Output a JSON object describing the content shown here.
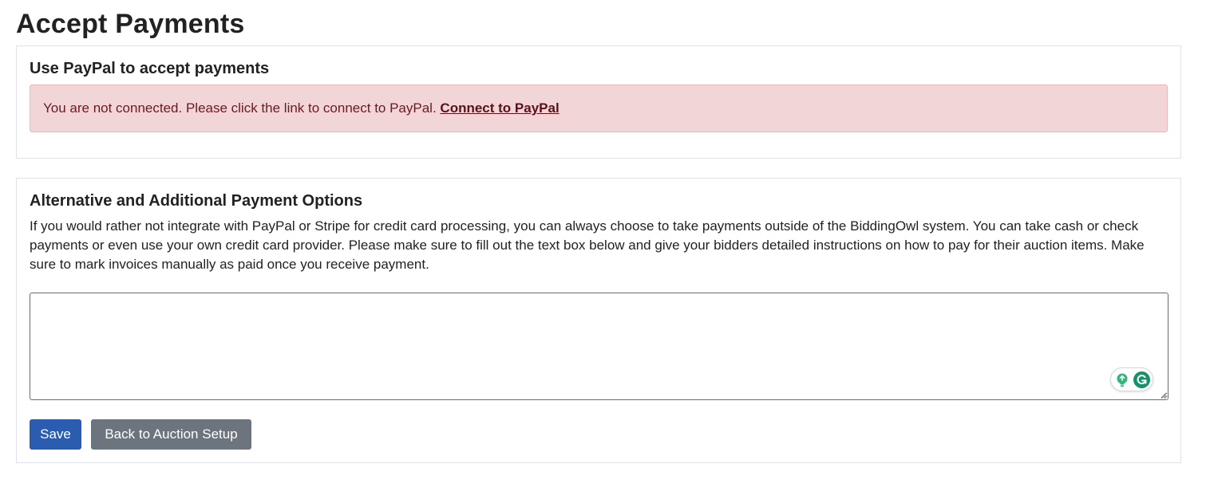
{
  "page": {
    "title": "Accept Payments"
  },
  "paypal_section": {
    "title": "Use PayPal to accept payments",
    "alert_text": "You are not connected. Please click the link to connect to PayPal.",
    "connect_link": "Connect to PayPal"
  },
  "alt_section": {
    "title": "Alternative and Additional Payment Options",
    "description": "If you would rather not integrate with PayPal or Stripe for credit card processing, you can always choose to take payments outside of the BiddingOwl system. You can take cash or check payments or even use your own credit card provider. Please make sure to fill out the text box below and give your bidders detailed instructions on how to pay for their auction items. Make sure to mark invoices manually as paid once you receive payment.",
    "instructions_value": "",
    "save_label": "Save",
    "back_label": "Back to Auction Setup"
  },
  "colors": {
    "alert_bg": "#f2d5d7",
    "alert_text": "#6a1a21",
    "primary_button": "#2a5db0",
    "secondary_button": "#6c757d",
    "textarea_focus_border": "#3a8a4a",
    "grammarly_green": "#15906b"
  },
  "icons": {
    "grammarly_suggestion": "lightbulb-icon",
    "grammarly_logo": "grammarly-g-icon"
  }
}
